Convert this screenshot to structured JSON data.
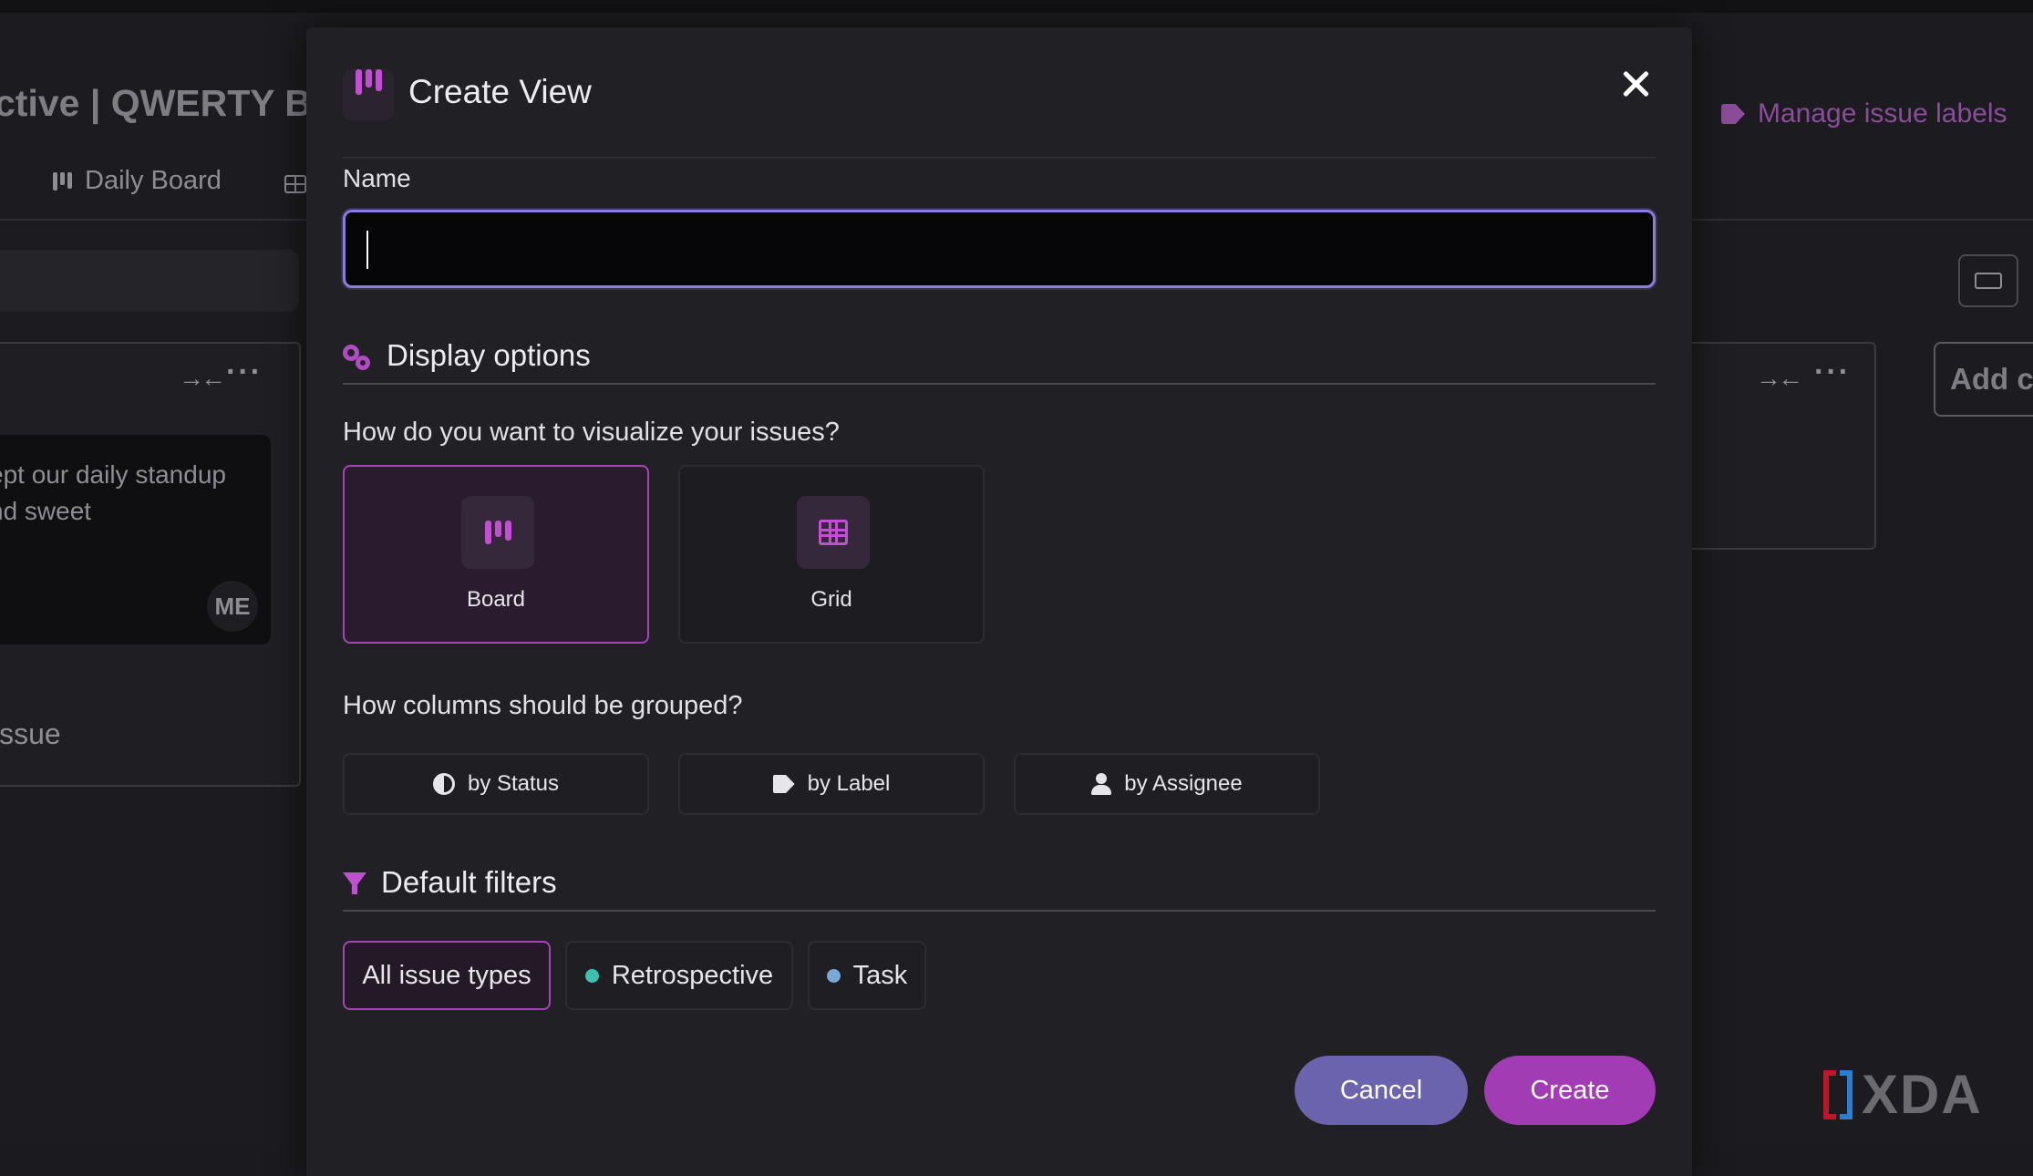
{
  "background": {
    "title": "ctive | QWERTY B",
    "tabs": [
      {
        "label": "Daily Board"
      }
    ],
    "manage_labels": "Manage issue labels",
    "card_text": "ept our daily standup\nnd sweet",
    "card_avatar": "ME",
    "add_issue": "issue",
    "add_column": "Add c",
    "watermark": "XDA"
  },
  "modal": {
    "title": "Create View",
    "name_label": "Name",
    "name_value": "",
    "display_section": "Display options",
    "visualize_question": "How do you want to visualize your issues?",
    "visualize_options": [
      {
        "label": "Board",
        "icon": "board-icon",
        "selected": true
      },
      {
        "label": "Grid",
        "icon": "grid-icon",
        "selected": false
      }
    ],
    "group_question": "How columns should be grouped?",
    "group_options": [
      {
        "label": "by Status",
        "icon": "half-circle-icon"
      },
      {
        "label": "by Label",
        "icon": "tags-icon"
      },
      {
        "label": "by Assignee",
        "icon": "user-icon"
      }
    ],
    "filters_section": "Default filters",
    "filters": [
      {
        "label": "All issue types",
        "selected": true
      },
      {
        "label": "Retrospective",
        "dot_color": "#3fbfb0"
      },
      {
        "label": "Task",
        "dot_color": "#7aa7d6"
      }
    ],
    "cancel_label": "Cancel",
    "create_label": "Create"
  },
  "colors": {
    "accent": "#c14fd1",
    "selected_border": "#a544b8",
    "cancel_bg": "#6b63ad",
    "create_bg": "#a13cb4",
    "input_focus": "#8a7de0"
  }
}
